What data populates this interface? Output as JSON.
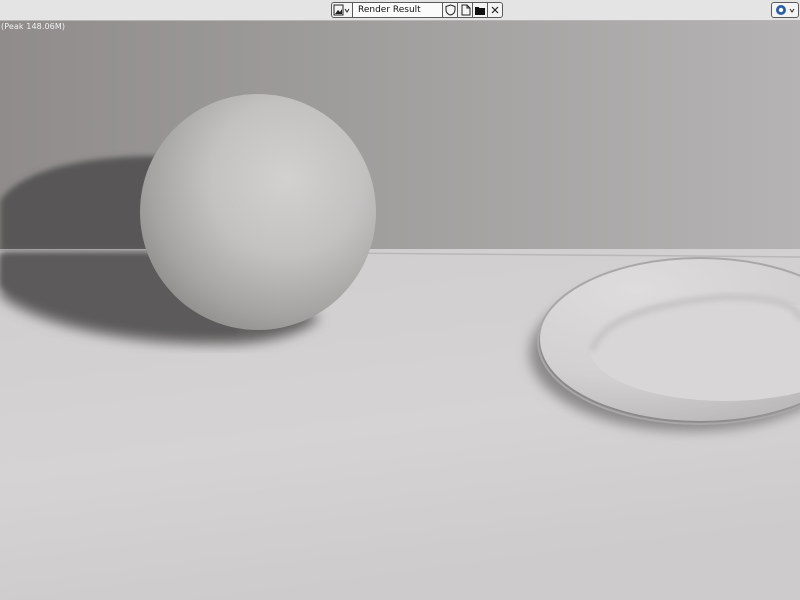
{
  "header": {
    "image_name": "Render Result",
    "icons": {
      "image_type": "image-browse-icon",
      "fake_user": "fake-user-shield-icon",
      "new_image": "new-image-icon",
      "open_image": "open-folder-icon",
      "unlink": "close-x-icon",
      "scene": "blender-scene-icon"
    }
  },
  "viewport": {
    "status": "(Peak 148.06M)"
  },
  "colors": {
    "header_bg": "#e4e4e4",
    "field_bg": "#fbfbfb",
    "scene_icon": "#2b5ea8"
  }
}
